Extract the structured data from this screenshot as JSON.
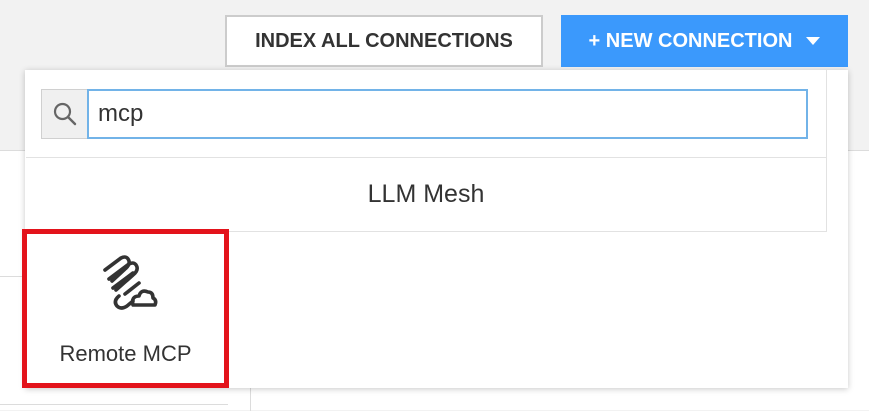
{
  "toolbar": {
    "index_all_label": "INDEX ALL CONNECTIONS",
    "new_connection_label": "+ NEW CONNECTION"
  },
  "search": {
    "value": "mcp",
    "icon": "search-icon"
  },
  "category": {
    "label": "LLM Mesh"
  },
  "results": [
    {
      "label": "Remote MCP",
      "icon": "mcp-cloud-icon",
      "highlighted": true
    }
  ],
  "colors": {
    "primary_button": "#3b99fc",
    "highlight_border": "#e3131b",
    "input_focus_border": "#72b3e8"
  }
}
